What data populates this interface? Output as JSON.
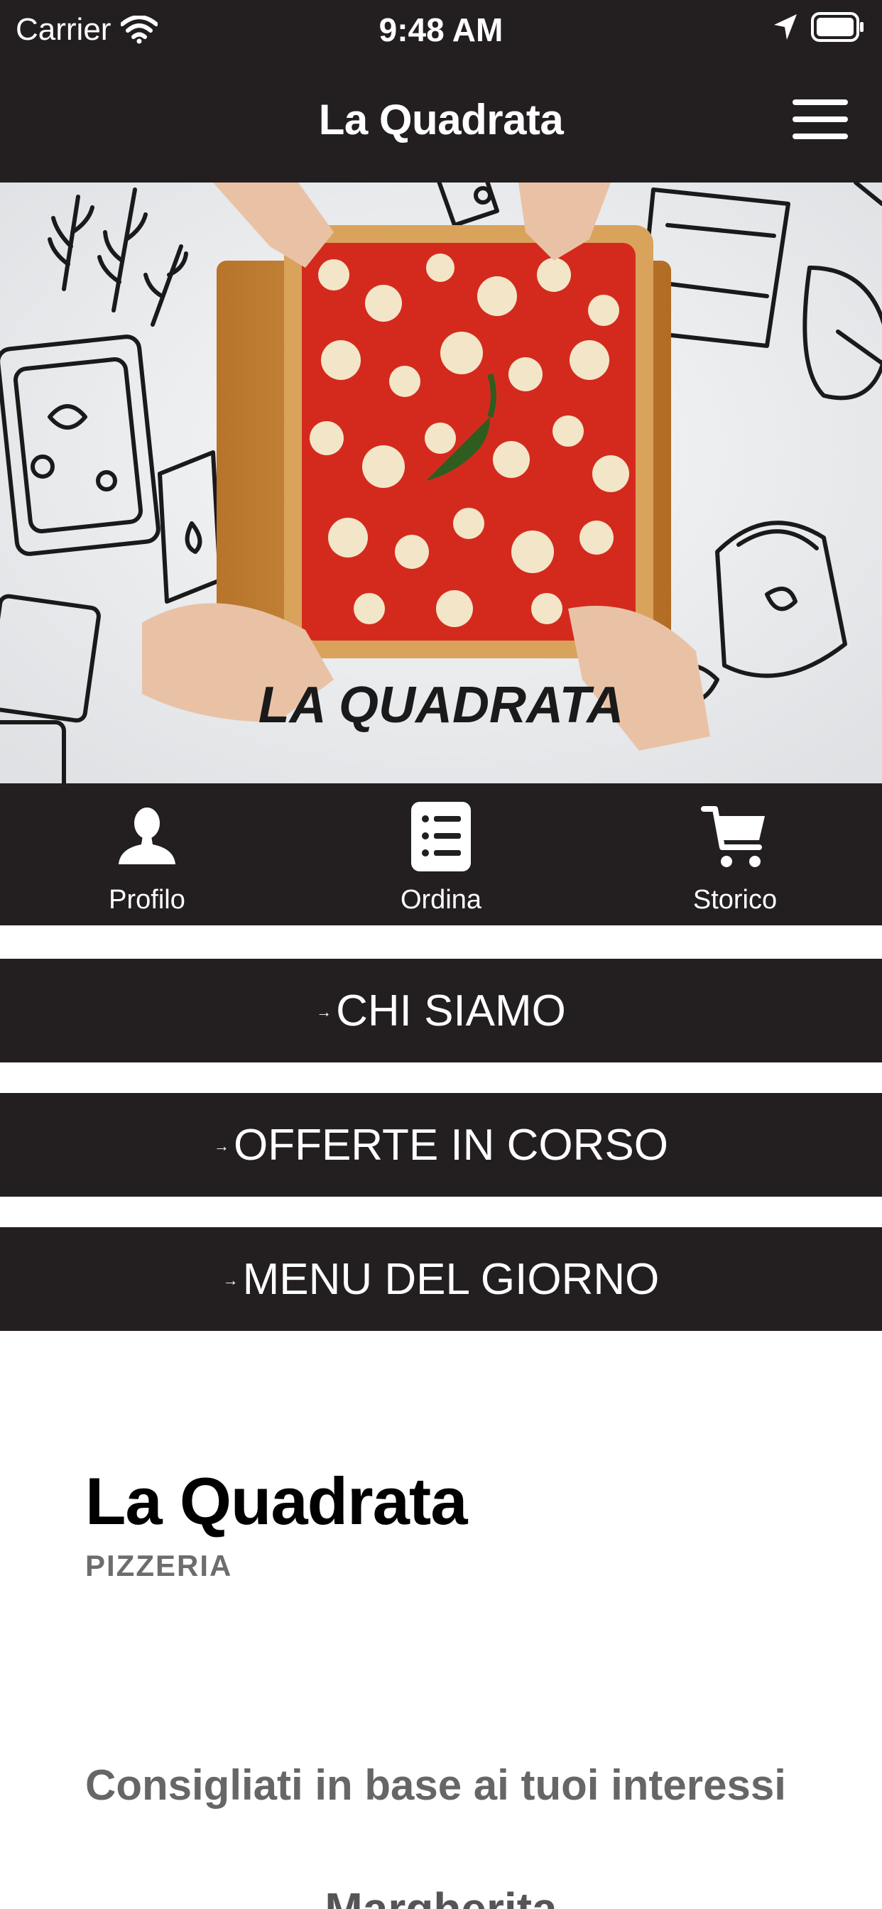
{
  "status_bar": {
    "carrier": "Carrier",
    "time": "9:48 AM"
  },
  "nav": {
    "title": "La Quadrata",
    "menu_icon": "hamburger-menu-icon"
  },
  "hero": {
    "logo_text": "LA QUADRATA"
  },
  "tabs": [
    {
      "label": "Profilo",
      "icon": "user-icon"
    },
    {
      "label": "Ordina",
      "icon": "list-icon"
    },
    {
      "label": "Storico",
      "icon": "cart-icon"
    }
  ],
  "actions": [
    {
      "label": "CHI SIAMO"
    },
    {
      "label": "OFFERTE IN CORSO"
    },
    {
      "label": "MENU DEL GIORNO"
    }
  ],
  "business": {
    "name": "La Quadrata",
    "category": "PIZZERIA"
  },
  "recommended": {
    "title": "Consigliati in base ai tuoi interessi",
    "first_item": "Margherita"
  },
  "colors": {
    "bar_background": "#231f20",
    "text_on_dark": "#ffffff",
    "muted_text": "#6d6d6d"
  }
}
